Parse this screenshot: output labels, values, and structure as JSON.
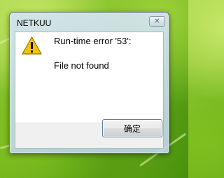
{
  "window": {
    "title": "NETKUU",
    "close_icon": "close-icon"
  },
  "message": {
    "icon": "warning-icon",
    "line1": "Run-time error '53':",
    "line2": "File not found"
  },
  "buttons": {
    "ok_label": "确定"
  },
  "colors": {
    "warning_fill": "#f5c400",
    "warning_stroke": "#9a7400",
    "button_border": "#5f7f9e"
  }
}
